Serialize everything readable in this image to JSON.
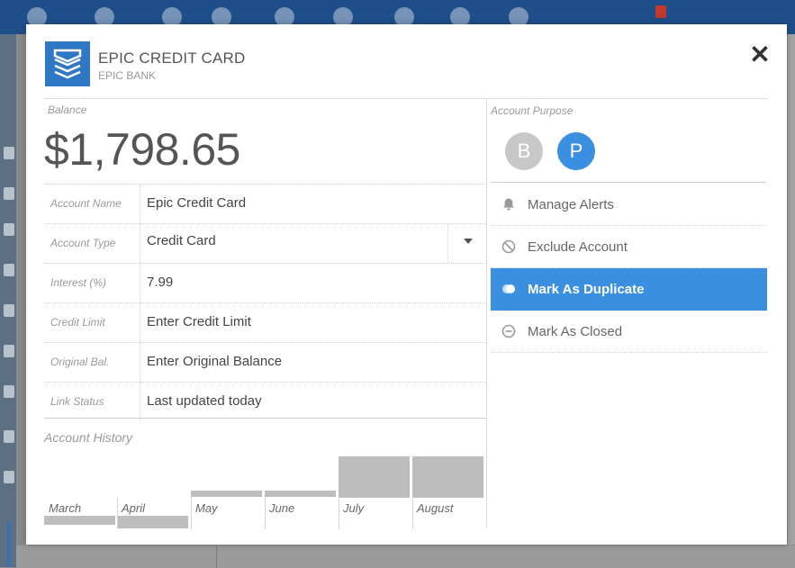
{
  "modal": {
    "title": "EPIC CREDIT CARD",
    "subtitle": "EPIC BANK",
    "close_icon": "close-icon",
    "accent_color": "#3b8fe0"
  },
  "balance": {
    "label": "Balance",
    "value": "$1,798.65"
  },
  "form": {
    "rows": [
      {
        "label": "Account Name",
        "value": "Epic Credit Card"
      },
      {
        "label": "Account Type",
        "value": "Credit Card"
      },
      {
        "label": "Interest (%)",
        "value": "7.99"
      },
      {
        "label": "Credit Limit",
        "value": "Enter Credit Limit"
      },
      {
        "label": "Original Bal.",
        "value": "Enter Original Balance"
      },
      {
        "label": "Link Status",
        "value": "Last updated today"
      }
    ]
  },
  "history": {
    "label": "Account History",
    "months": [
      "March",
      "April",
      "May",
      "June",
      "July",
      "August"
    ]
  },
  "purpose": {
    "label": "Account Purpose",
    "business": "B",
    "personal": "P",
    "selected": "P"
  },
  "menu": {
    "items": [
      {
        "label": "Manage Alerts",
        "icon": "bell-icon"
      },
      {
        "label": "Exclude Account",
        "icon": "prohibit-icon"
      },
      {
        "label": "Mark As Duplicate",
        "icon": "duplicate-icon",
        "active": true
      },
      {
        "label": "Mark As Closed",
        "icon": "minus-circle-icon"
      }
    ]
  }
}
